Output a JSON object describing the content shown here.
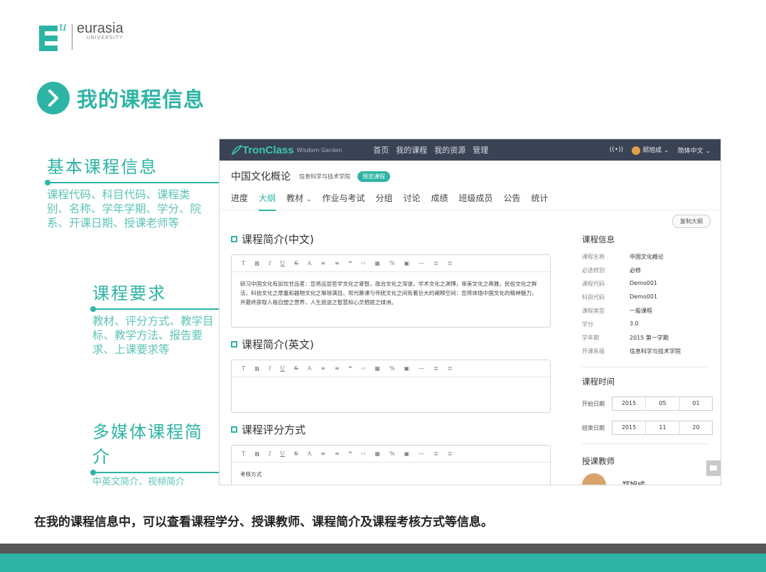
{
  "logo": {
    "mark_letter": "U",
    "name": "eurasia",
    "sub": "UNIVERSITY"
  },
  "heading": {
    "title": "我的课程信息",
    "color": "#2eb4a4"
  },
  "annotations": [
    {
      "title": "基本课程信息",
      "desc": "课程代码、科目代码、课程类别、名称、学年学期、学分、院系、开课日期、授课老师等"
    },
    {
      "title": "课程要求",
      "desc": "教材、评分方式、教学目标、教学方法、报告要求、上课要求等"
    },
    {
      "title": "多媒体课程简介",
      "desc": "中英文简介、视频简介"
    }
  ],
  "app": {
    "brand": "TronClass",
    "brand_sub": "Wisdom Garden",
    "nav": [
      "首页",
      "我的课程",
      "我的资源",
      "管理"
    ],
    "user": "郑旭成",
    "language": "简体中文",
    "course_name": "中国文化概论",
    "course_dept": "信息科学与技术学院",
    "course_badge": "预览课程",
    "tabs": [
      "进度",
      "大纲",
      "教材",
      "作业与考试",
      "分组",
      "讨论",
      "成绩",
      "班级成员",
      "公告",
      "统计"
    ],
    "active_tab": "大纲",
    "copy_button": "复制大纲",
    "toolbar_icons": [
      "T",
      "B",
      "I",
      "U",
      "S",
      "A",
      "≡",
      "≡",
      "❝",
      "‹›",
      "▦",
      "%",
      "▣",
      "—",
      "≣",
      "≣"
    ],
    "sections": [
      {
        "title": "课程简介(中文)",
        "body": "研习中国文化有如饮甘品茗：您将品尝哲学文化之睿智，政治文化之深遂，学术文化之渊博，审美文化之典雅，民俗文化之鲜活，科技文化之厚重和器物文化之琳琅满目。现代慕课与传统文化之间有着巨大的阐释空间：您将体悟中国文化的精神魅力，并最终获取人格自塑之营养，人生旅途之智慧和心灵栖居之绿洲。"
      },
      {
        "title": "课程简介(英文)",
        "body": ""
      },
      {
        "title": "课程评分方式",
        "body": "考核方式"
      }
    ],
    "info_title": "课程信息",
    "info": [
      {
        "k": "课程名称",
        "v": "中国文化概论"
      },
      {
        "k": "必选修别",
        "v": "必修"
      },
      {
        "k": "课程代码",
        "v": "Demo001"
      },
      {
        "k": "科目代码",
        "v": "Demo001"
      },
      {
        "k": "课程类型",
        "v": "一般课程"
      },
      {
        "k": "学分",
        "v": "3.0"
      },
      {
        "k": "学年期",
        "v": "2015 第一学期"
      },
      {
        "k": "开课系级",
        "v": "信息科学与技术学院"
      }
    ],
    "time_title": "课程时间",
    "start_label": "开始日期",
    "start": [
      "2015",
      "05",
      "01"
    ],
    "end_label": "结束日期",
    "end": [
      "2015",
      "11",
      "20"
    ],
    "teacher_title": "授课教师",
    "teacher_name": "郑旭成"
  },
  "caption": "在我的课程信息中，可以查看课程学分、授课教师、课程简介及课程考核方式等信息。"
}
